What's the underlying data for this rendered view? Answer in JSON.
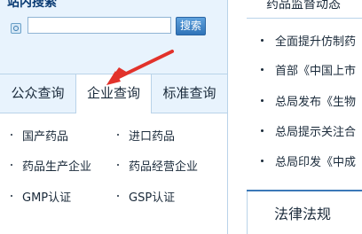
{
  "search": {
    "heading": "站内搜索",
    "input_value": "",
    "button_label": "搜索"
  },
  "tabs": [
    {
      "label": "公众查询"
    },
    {
      "label": "企业查询"
    },
    {
      "label": "标准查询"
    }
  ],
  "links": [
    {
      "label": "国产药品"
    },
    {
      "label": "进口药品"
    },
    {
      "label": "药品生产企业"
    },
    {
      "label": "药品经营企业"
    },
    {
      "label": "GMP认证"
    },
    {
      "label": "GSP认证"
    }
  ],
  "right": {
    "heading": "药品监督动态",
    "news": [
      {
        "text": "全面提升仿制药"
      },
      {
        "text": "首部《中国上市"
      },
      {
        "text": "总局发布《生物"
      },
      {
        "text": "总局提示关注合"
      },
      {
        "text": "总局印发《中成"
      }
    ],
    "law_title": "法律法规"
  },
  "colors": {
    "accent": "#3b78b8",
    "panel_bg": "#e8f3fd",
    "border": "#b9d3e9",
    "arrow": "#e2322b"
  }
}
